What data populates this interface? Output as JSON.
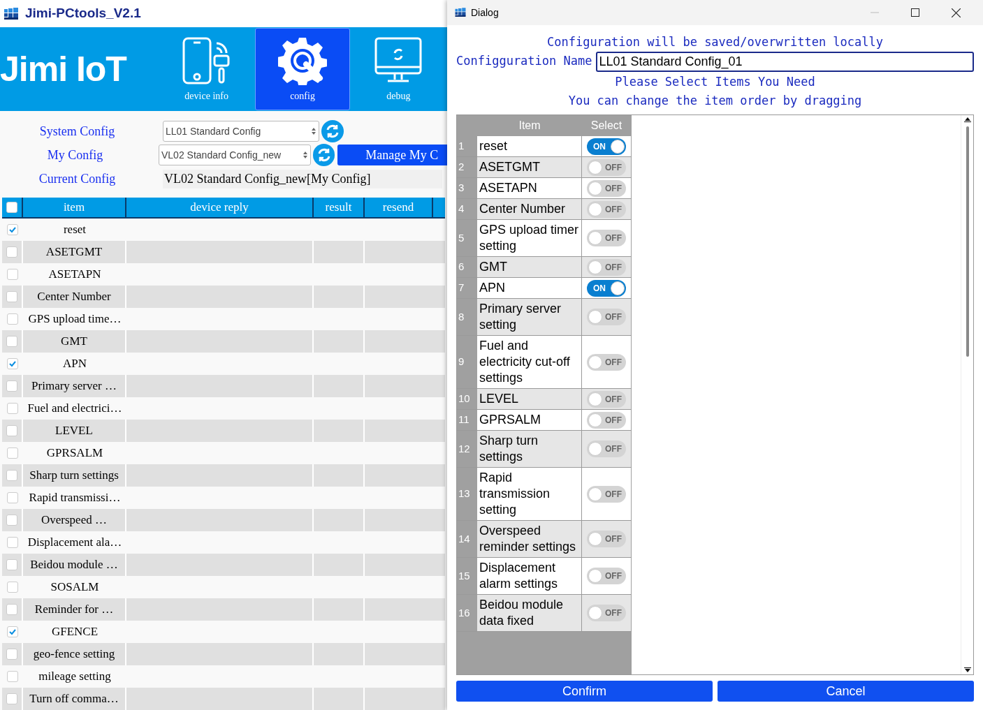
{
  "app": {
    "title": "Jimi-PCtools_V2.1",
    "logo": "Jimi IoT",
    "nav": [
      {
        "label": "device info",
        "kind": "phone",
        "selected": false
      },
      {
        "label": "config",
        "kind": "gear",
        "selected": true
      },
      {
        "label": "debug",
        "kind": "monitor",
        "selected": false
      }
    ],
    "system_config": {
      "label": "System Config",
      "value": "LL01 Standard Config"
    },
    "my_config": {
      "label": "My Config",
      "value": "VL02 Standard Config_new",
      "button": "Manage My C"
    },
    "current_config": {
      "label": "Current Config",
      "value": "VL02 Standard Config_new[My Config]"
    },
    "table": {
      "select_all": false,
      "columns": [
        "item",
        "device reply",
        "result",
        "resend"
      ],
      "rows": [
        {
          "item": "reset",
          "checked": true
        },
        {
          "item": "ASETGMT",
          "checked": false
        },
        {
          "item": "ASETAPN",
          "checked": false
        },
        {
          "item": "Center Number",
          "checked": false
        },
        {
          "item": "GPS upload time…",
          "checked": false
        },
        {
          "item": "GMT",
          "checked": false
        },
        {
          "item": "APN",
          "checked": true
        },
        {
          "item": "Primary server …",
          "checked": false
        },
        {
          "item": "Fuel and electrici…",
          "checked": false
        },
        {
          "item": "LEVEL",
          "checked": false
        },
        {
          "item": "GPRSALM",
          "checked": false
        },
        {
          "item": "Sharp turn settings",
          "checked": false
        },
        {
          "item": "Rapid transmissi…",
          "checked": false
        },
        {
          "item": "Overspeed …",
          "checked": false
        },
        {
          "item": "Displacement ala…",
          "checked": false
        },
        {
          "item": "Beidou module …",
          "checked": false
        },
        {
          "item": "SOSALM",
          "checked": false
        },
        {
          "item": "Reminder for …",
          "checked": false
        },
        {
          "item": "GFENCE",
          "checked": true
        },
        {
          "item": "geo-fence setting",
          "checked": false
        },
        {
          "item": "mileage setting",
          "checked": false
        },
        {
          "item": "Turn off comma…",
          "checked": false
        }
      ]
    }
  },
  "dialog": {
    "title": "Dialog",
    "notice": "Configuration will be saved/overwritten locally",
    "name_label": "Configguration Name",
    "name_value": "LL01 Standard Config_01",
    "hint_1": "Please Select Items You Need",
    "hint_2": "You can change the item order by dragging",
    "columns": [
      "Item",
      "Select"
    ],
    "rows": [
      {
        "number": "1",
        "item": "reset",
        "on": true,
        "switch_text": "ON"
      },
      {
        "number": "2",
        "item": "ASETGMT",
        "on": false,
        "switch_text": "OFF"
      },
      {
        "number": "3",
        "item": "ASETAPN",
        "on": false,
        "switch_text": "OFF"
      },
      {
        "number": "4",
        "item": "Center Number",
        "on": false,
        "switch_text": "OFF"
      },
      {
        "number": "5",
        "item": "GPS upload timer setting",
        "on": false,
        "switch_text": "OFF"
      },
      {
        "number": "6",
        "item": "GMT",
        "on": false,
        "switch_text": "OFF"
      },
      {
        "number": "7",
        "item": "APN",
        "on": true,
        "switch_text": "ON"
      },
      {
        "number": "8",
        "item": "Primary server setting",
        "on": false,
        "switch_text": "OFF"
      },
      {
        "number": "9",
        "item": "Fuel and electricity cut-off settings",
        "on": false,
        "switch_text": "OFF"
      },
      {
        "number": "10",
        "item": "LEVEL",
        "on": false,
        "switch_text": "OFF"
      },
      {
        "number": "11",
        "item": "GPRSALM",
        "on": false,
        "switch_text": "OFF"
      },
      {
        "number": "12",
        "item": "Sharp turn settings",
        "on": false,
        "switch_text": "OFF"
      },
      {
        "number": "13",
        "item": "Rapid transmission setting",
        "on": false,
        "switch_text": "OFF"
      },
      {
        "number": "14",
        "item": "Overspeed reminder settings",
        "on": false,
        "switch_text": "OFF"
      },
      {
        "number": "15",
        "item": "Displacement alarm settings",
        "on": false,
        "switch_text": "OFF"
      },
      {
        "number": "16",
        "item": "Beidou module data fixed",
        "on": false,
        "switch_text": "OFF"
      }
    ],
    "buttons": [
      "Confirm",
      "Cancel"
    ]
  }
}
